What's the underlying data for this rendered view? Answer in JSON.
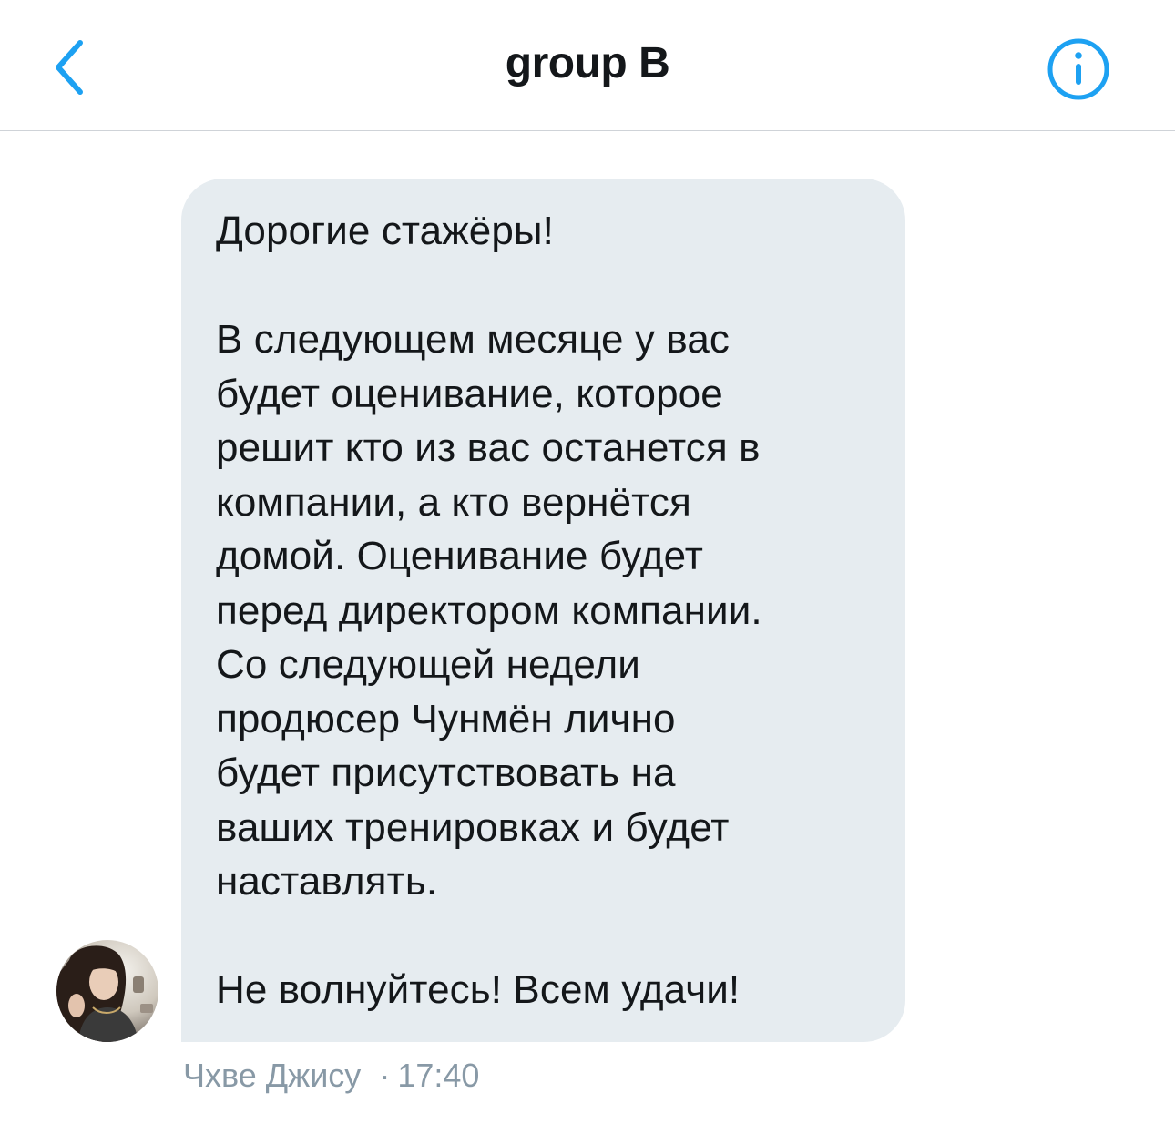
{
  "header": {
    "title": "group B",
    "back_icon": "chevron-left-icon",
    "info_icon": "info-circle-icon",
    "accent_color": "#1da1f2"
  },
  "message": {
    "text": "Дорогие стажёры!\n\nВ следующем месяце у вас\nбудет оценивание, которое\nрешит кто из вас останется в\nкомпании, а кто вернётся\nдомой. Оценивание будет\nперед директором компании.\nСо следующей недели\nпродюсер Чунмён лично\nбудет присутствовать на\nваших тренировках и будет\nнаставлять.\n\nНе волнуйтесь! Всем удачи!",
    "sender": "Чхве Джису",
    "separator": "·",
    "time": "17:40",
    "bubble_color": "#e6ecf0"
  }
}
